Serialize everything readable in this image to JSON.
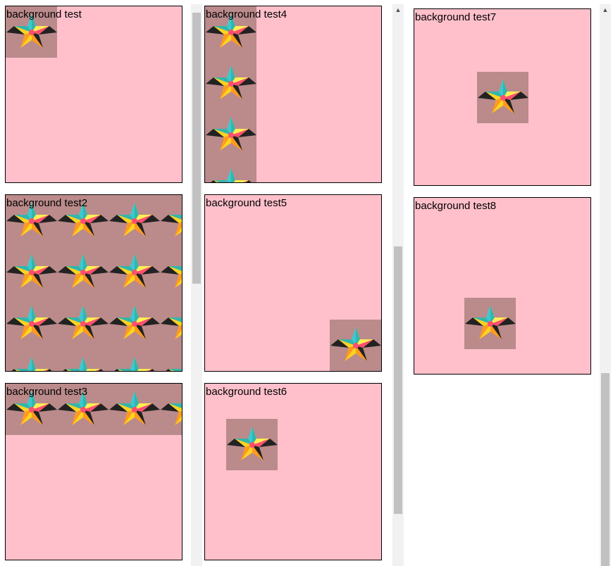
{
  "boxes": [
    {
      "label": "background test"
    },
    {
      "label": "background test2"
    },
    {
      "label": "background test3"
    },
    {
      "label": "background test4"
    },
    {
      "label": "background test5"
    },
    {
      "label": "background test6"
    },
    {
      "label": "background test7"
    },
    {
      "label": "background test8"
    }
  ],
  "colors": {
    "box_background": "#ffc0cb",
    "tile_background": "#bb8a8b",
    "scroll_track": "#f1f1f1",
    "scroll_thumb": "#c1c1c1"
  },
  "icons": {
    "tile": "star-tile-icon",
    "scroll_up": "scroll-up-arrow-icon"
  }
}
